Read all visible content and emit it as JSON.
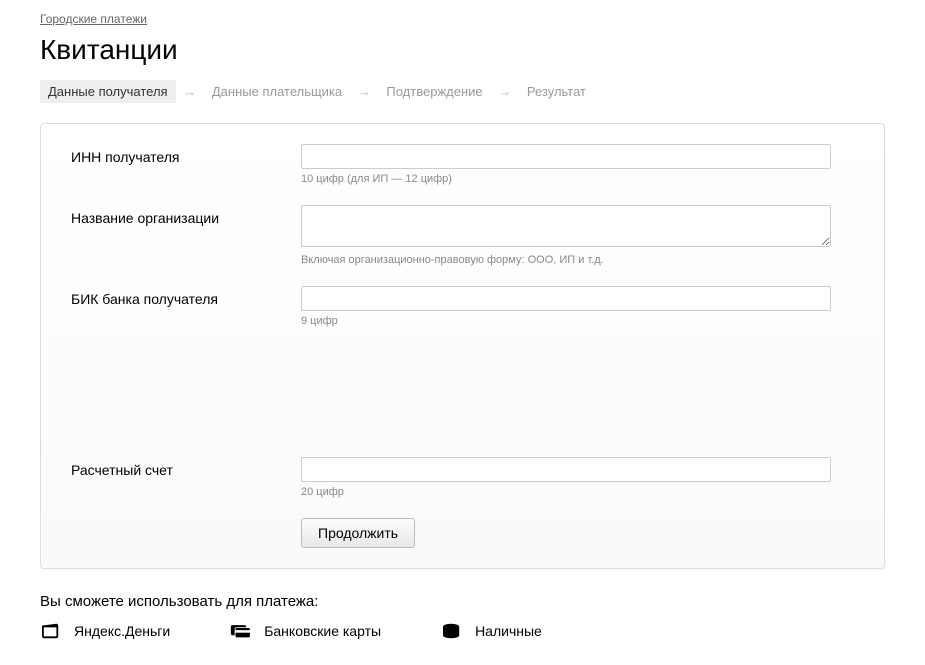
{
  "breadcrumb": {
    "link": "Городские платежи"
  },
  "page": {
    "title": "Квитанции"
  },
  "steps": {
    "items": [
      {
        "label": "Данные получателя"
      },
      {
        "label": "Данные плательщика"
      },
      {
        "label": "Подтверждение"
      },
      {
        "label": "Результат"
      }
    ],
    "separator": "→"
  },
  "form": {
    "inn": {
      "label": "ИНН получателя",
      "value": "",
      "hint": "10 цифр (для ИП — 12 цифр)"
    },
    "org": {
      "label": "Название организации",
      "value": "",
      "hint": "Включая организационно-правовую форму: ООО, ИП и т.д."
    },
    "bik": {
      "label": "БИК банка получателя",
      "value": "",
      "hint": "9 цифр"
    },
    "acct": {
      "label": "Расчетный счет",
      "value": "",
      "hint": "20 цифр"
    },
    "submit": "Продолжить"
  },
  "payment": {
    "heading": "Вы сможете использовать для платежа:",
    "methods": {
      "yamoney": "Яндекс.Деньги",
      "cards": "Банковские карты",
      "cash": "Наличные"
    }
  }
}
